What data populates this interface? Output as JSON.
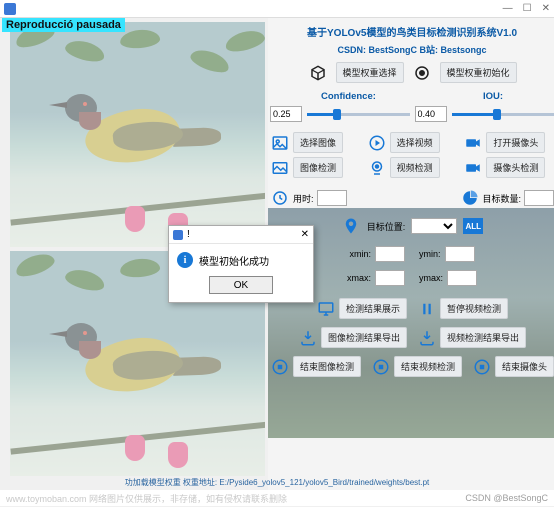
{
  "window": {
    "title": "",
    "play_notice": "Reproducció pausada",
    "min": "—",
    "max": "☐",
    "close": "✕"
  },
  "header": {
    "title": "基于YOLOv5模型的鸟类目标检测识别系统V1.0",
    "subtitle": "CSDN: BestSongC   B站: Bestsongc"
  },
  "weights": {
    "select_btn": "模型权重选择",
    "init_btn": "模型权重初始化"
  },
  "params": {
    "conf_label": "Confidence:",
    "conf_value": "0.25",
    "iou_label": "IOU:",
    "iou_value": "0.40"
  },
  "sources": {
    "sel_image": "选择图像",
    "sel_video": "选择视频",
    "open_cam": "打开摄像头",
    "det_image": "图像检测",
    "det_video": "视频检测",
    "det_cam": "摄像头检测"
  },
  "stats": {
    "time_label": "用时:",
    "time_value": "",
    "count_label": "目标数量:",
    "count_value": "",
    "pos_label": "目标位置:",
    "all": "ALL"
  },
  "coords": {
    "xmin": "xmin:",
    "ymin": "ymin:",
    "xmax": "xmax:",
    "ymax": "ymax:"
  },
  "actions": {
    "show_result": "检测结果展示",
    "pause_video": "暂停视频检测",
    "export_img": "图像检测结果导出",
    "export_vid": "视频检测结果导出",
    "end_img": "结束图像检测",
    "end_vid": "结束视频检测",
    "end_cam": "结束摄像头"
  },
  "footer": "功加载模型权重  权重地址: E:/Pyside6_yolov5_121/yolov5_Bird/trained/weights/best.pt",
  "caption": {
    "left": "www.toymoban.com  网络图片仅供展示，非存储，如有侵权请联系删除",
    "right": "CSDN @BestSongC"
  },
  "modal": {
    "title": "!",
    "message": "模型初始化成功",
    "ok": "OK"
  }
}
